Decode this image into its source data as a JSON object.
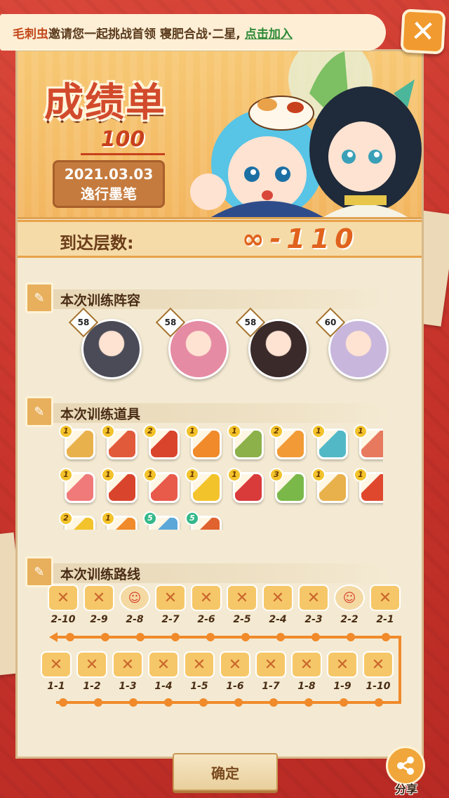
{
  "invite": {
    "inviter": "毛刺虫",
    "message": "邀请您一起挑战首领 寝肥合战·二星,",
    "join_label": "点击加入"
  },
  "close_label": "✕",
  "report": {
    "title": "成绩单",
    "score": "100",
    "date": "2021.03.03",
    "player": "逸行墨笔"
  },
  "floor": {
    "label": "到达层数:",
    "value": "∞-110"
  },
  "lineup": {
    "title": "本次训练阵容",
    "heroes": [
      {
        "level": "58",
        "icon": "masked-oni-hero",
        "color": "#4b4b57"
      },
      {
        "level": "58",
        "icon": "pink-kimono-hero",
        "color": "#e58ba3"
      },
      {
        "level": "58",
        "icon": "dark-hair-hero",
        "color": "#3a2a2a"
      },
      {
        "level": "60",
        "icon": "silver-hair-hero",
        "color": "#c8b6dc"
      }
    ]
  },
  "items": {
    "title": "本次训练道具",
    "list": [
      {
        "count": "1",
        "icon": "sword-up-icon",
        "color": "#e9b14b"
      },
      {
        "count": "1",
        "icon": "heart-fox-icon",
        "color": "#e15b3b"
      },
      {
        "count": "2",
        "icon": "axe-up-icon",
        "color": "#d9452c"
      },
      {
        "count": "1",
        "icon": "star-up-icon",
        "color": "#f08a2a"
      },
      {
        "count": "1",
        "icon": "scroll-sword-icon",
        "color": "#8cb04a"
      },
      {
        "count": "2",
        "icon": "blade-up-icon",
        "color": "#f29a35"
      },
      {
        "count": "1",
        "icon": "bird-icon",
        "color": "#52b8c6"
      },
      {
        "count": "1",
        "icon": "wing-icon",
        "color": "#e77a5e"
      },
      {
        "count": "1",
        "icon": "red-fan-icon",
        "color": "#f07a7a"
      },
      {
        "count": "1",
        "icon": "gift-up-icon",
        "color": "#d9452c"
      },
      {
        "count": "1",
        "icon": "flower-sword-icon",
        "color": "#e85a4a"
      },
      {
        "count": "1",
        "icon": "gold-ring-icon",
        "color": "#f3c32c"
      },
      {
        "count": "1",
        "icon": "plum-c-icon",
        "color": "#d93a3a"
      },
      {
        "count": "3",
        "icon": "green-tome-icon",
        "color": "#7ab84a"
      },
      {
        "count": "1",
        "icon": "umbrella-sword-icon",
        "color": "#e9b14b"
      },
      {
        "count": "1",
        "icon": "plum-blossom-icon",
        "color": "#e0482e"
      },
      {
        "count": "2",
        "icon": "gold-flower-icon",
        "color": "#f3c32c"
      },
      {
        "count": "1",
        "icon": "orange-orb-icon",
        "color": "#f08a2a"
      },
      {
        "count": "5",
        "icon": "blue-shield-icon",
        "color": "#5aa7d8",
        "green": true
      },
      {
        "count": "5",
        "icon": "maple-leaf-icon",
        "color": "#e0622e",
        "green": true
      }
    ]
  },
  "route": {
    "title": "本次训练路线",
    "row2": [
      {
        "label": "2-10",
        "type": "battle"
      },
      {
        "label": "2-9",
        "type": "battle"
      },
      {
        "label": "2-8",
        "type": "cat"
      },
      {
        "label": "2-7",
        "type": "battle"
      },
      {
        "label": "2-6",
        "type": "battle"
      },
      {
        "label": "2-5",
        "type": "battle"
      },
      {
        "label": "2-4",
        "type": "battle"
      },
      {
        "label": "2-3",
        "type": "battle"
      },
      {
        "label": "2-2",
        "type": "cat"
      },
      {
        "label": "2-1",
        "type": "battle"
      }
    ],
    "row1": [
      {
        "label": "1-1",
        "type": "battle"
      },
      {
        "label": "1-2",
        "type": "battle"
      },
      {
        "label": "1-3",
        "type": "battle"
      },
      {
        "label": "1-4",
        "type": "battle"
      },
      {
        "label": "1-5",
        "type": "battle"
      },
      {
        "label": "1-6",
        "type": "battle"
      },
      {
        "label": "1-7",
        "type": "battle"
      },
      {
        "label": "1-8",
        "type": "battle"
      },
      {
        "label": "1-9",
        "type": "battle"
      },
      {
        "label": "1-10",
        "type": "battle"
      }
    ]
  },
  "buttons": {
    "confirm": "确定",
    "share": "分享"
  }
}
